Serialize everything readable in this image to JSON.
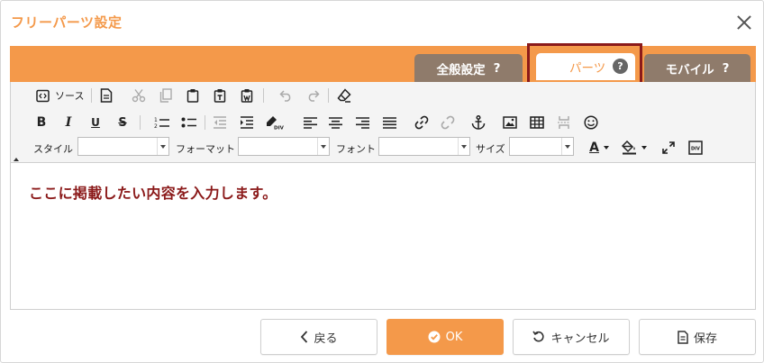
{
  "dialog": {
    "title": "フリーパーツ設定"
  },
  "tabs": {
    "general": "全般設定",
    "parts": "パーツ",
    "mobile": "モバイル",
    "help_mark": "?"
  },
  "toolbar": {
    "source_label": "ソース",
    "style_label": "スタイル",
    "format_label": "フォーマット",
    "font_label": "フォント",
    "size_label": "サイズ",
    "style_value": "",
    "format_value": "",
    "font_value": "",
    "size_value": "",
    "bold": "B",
    "italic": "I",
    "underline": "U",
    "strike": "S",
    "text_color": "A",
    "div_label": "DIV",
    "icons": [
      "source-icon",
      "template-icon",
      "cut-icon",
      "copy-icon",
      "paste-icon",
      "paste-text-icon",
      "paste-word-icon",
      "undo-icon",
      "redo-icon",
      "remove-format-icon",
      "numbered-list-icon",
      "bulleted-list-icon",
      "outdent-icon",
      "indent-icon",
      "create-div-icon",
      "align-left-icon",
      "align-center-icon",
      "align-right-icon",
      "justify-icon",
      "link-icon",
      "unlink-icon",
      "anchor-icon",
      "image-icon",
      "table-icon",
      "page-break-icon",
      "smiley-icon",
      "text-color-icon",
      "background-color-icon",
      "maximize-icon",
      "show-blocks-icon"
    ]
  },
  "editor": {
    "content": "ここに掲載したい内容を入力します。"
  },
  "footer": {
    "back": "戻る",
    "ok": "OK",
    "cancel": "キャンセル",
    "save": "保存"
  },
  "colors": {
    "accent": "#f4994a",
    "tab_inactive": "#8f7b6b",
    "highlight_border": "#8b1a1a",
    "content_text": "#8b1a1a"
  }
}
